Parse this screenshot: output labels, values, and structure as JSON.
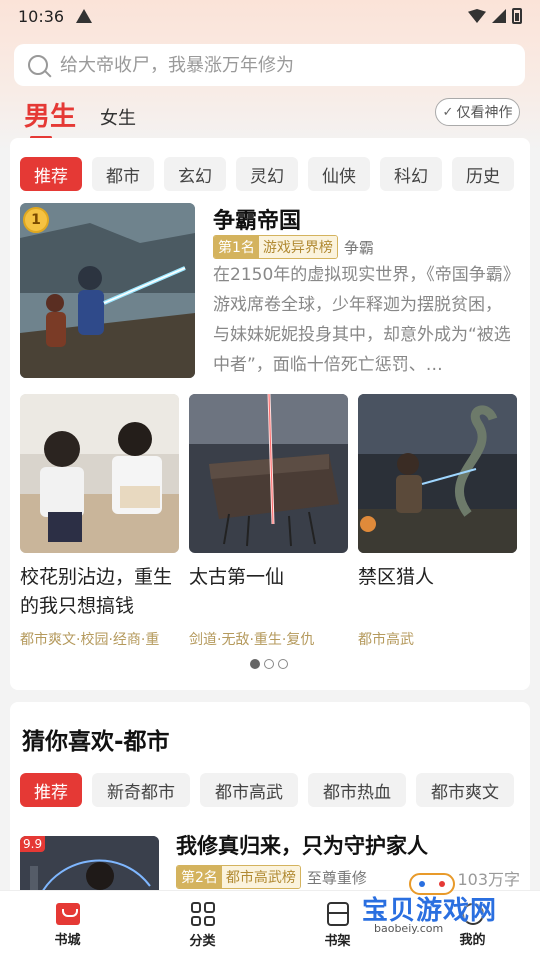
{
  "status_bar": {
    "time": "10:36"
  },
  "search": {
    "placeholder": "给大帝收尸，我暴涨万年修为"
  },
  "gender_tabs": {
    "active": "男生",
    "other": "女生"
  },
  "only_button": {
    "label": "仅看神作"
  },
  "featured_section": {
    "chips": [
      "推荐",
      "都市",
      "玄幻",
      "灵幻",
      "仙侠",
      "科幻",
      "历史"
    ],
    "featured": {
      "rank_badge": "1",
      "title": "争霸帝国",
      "rank_label": "第1名",
      "rank_list": "游戏异界榜",
      "tag": "争霸",
      "description": "在2150年的虚拟现实世界，《帝国争霸》游戏席卷全球，少年释迦为摆脱贫困，与妹妹妮妮投身其中，却意外成为“被选中者”，面临十倍死亡惩罚、…"
    },
    "books": [
      {
        "title": "校花别沾边，重生的我只想搞钱",
        "tags": "都市爽文·校园·经商·重"
      },
      {
        "title": "太古第一仙",
        "tags": "剑道·无敌·重生·复仇"
      },
      {
        "title": "禁区猎人",
        "tags": "都市高武"
      }
    ]
  },
  "guess_section": {
    "title": "猜你喜欢-都市",
    "chips": [
      "推荐",
      "新奇都市",
      "都市高武",
      "都市热血",
      "都市爽文"
    ],
    "book": {
      "score": "9.9",
      "title": "我修真归来，只为守护家人",
      "rank_label": "第2名",
      "rank_list": "都市高武榜",
      "tag": "至尊重修",
      "word_count": "103万字"
    }
  },
  "bottom_nav": {
    "items": [
      {
        "label": "书城",
        "icon": "bookstore-icon",
        "active": true
      },
      {
        "label": "分类",
        "icon": "category-icon",
        "active": false
      },
      {
        "label": "书架",
        "icon": "bookshelf-icon",
        "active": false
      },
      {
        "label": "我的",
        "icon": "profile-icon",
        "active": false
      }
    ]
  },
  "watermark": {
    "text": "宝贝游戏网",
    "url": "baobeiy.com"
  },
  "colors": {
    "accent": "#e53935",
    "gold": "#d4b35e",
    "tag_gold": "#b59a5d"
  }
}
